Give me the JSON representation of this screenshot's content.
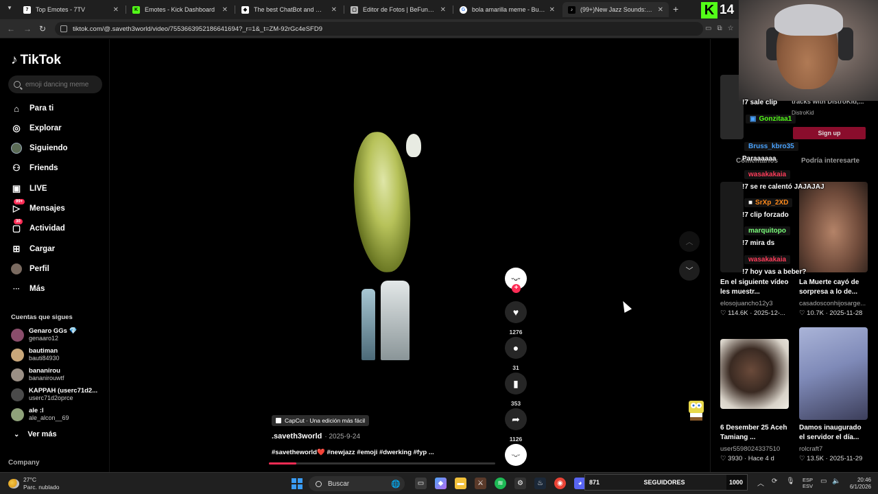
{
  "browser": {
    "tabs": [
      {
        "label": "Top Emotes - 7TV",
        "icon_color": "#ffffff",
        "active": false
      },
      {
        "label": "Emotes - Kick Dashboard",
        "icon_color": "#53fc18",
        "active": false
      },
      {
        "label": "The best ChatBot and Widgets",
        "icon_color": "#ffffff",
        "active": false
      },
      {
        "label": "Editor de Fotos | BeFunky: Edita",
        "icon_color": "#bbbbbb",
        "active": false
      },
      {
        "label": "bola amarilla meme - Buscar co",
        "icon_color": "#ffffff",
        "active": false
      },
      {
        "label": "(99+)New Jazz Sounds: Saving",
        "icon_color": "#ffffff",
        "active": true
      }
    ],
    "url": "tiktok.com/@.saveth3world/video/7553663952186641694?_r=1&_t=ZM-92rGc4eSFD9"
  },
  "tiktok": {
    "logo_text": "TikTok",
    "search_placeholder": "emoji dancing meme",
    "nav": [
      {
        "label": "Para ti",
        "icon": "home-icon",
        "glyph": "⌂"
      },
      {
        "label": "Explorar",
        "icon": "compass-icon",
        "glyph": "◎"
      },
      {
        "label": "Siguiendo",
        "icon": "following-avatar-icon",
        "glyph": "●"
      },
      {
        "label": "Friends",
        "icon": "friends-icon",
        "glyph": "⚇"
      },
      {
        "label": "LIVE",
        "icon": "live-icon",
        "glyph": "▣"
      },
      {
        "label": "Mensajes",
        "icon": "messages-icon",
        "glyph": "▷",
        "badge": "99+"
      },
      {
        "label": "Actividad",
        "icon": "activity-icon",
        "glyph": "▢",
        "badge": "30"
      },
      {
        "label": "Cargar",
        "icon": "upload-icon",
        "glyph": "⊞"
      },
      {
        "label": "Perfil",
        "icon": "profile-icon",
        "glyph": "●"
      },
      {
        "label": "Más",
        "icon": "more-icon",
        "glyph": "···"
      }
    ],
    "following_title": "Cuentas que sigues",
    "following": [
      {
        "name": "Genaro GGs 💎",
        "user": "genaaro12"
      },
      {
        "name": "bautiman",
        "user": "bauti84930"
      },
      {
        "name": "bananirou",
        "user": "bananirouwtf"
      },
      {
        "name": "KAPPAH (userc71d2...",
        "user": "userc71d2oprce"
      },
      {
        "name": "ale :l",
        "user": "ale_alcon__69"
      }
    ],
    "see_more": "Ver más",
    "company": "Company",
    "video": {
      "capcut_label": "CapCut · Una edición más fácil",
      "author": ".saveth3world",
      "date": "· 2025-9-24",
      "caption": "#savetheworld❤️ #newjazz #emoji #dwerking #fyp ...",
      "progress": 0.12,
      "likes": "1276",
      "comments": "31",
      "saves": "353",
      "shares": "1126"
    },
    "right": {
      "sale_clip": "!7 sale clip",
      "tracks_text": "tracks with DistroKid,...",
      "distrokid": "DistroKid",
      "signup": "Sign up",
      "tab_comments": "Comentarios",
      "tab_suggested": "Podría interesarte",
      "cards": [
        {
          "title": "En el siguiente vídeo les muestr...",
          "user": "elosojuancho12y3",
          "stats": "♡ 114.6K · 2025-12-..."
        },
        {
          "title": "La Muerte cayó de sorpresa a lo de...",
          "user": "casadosconhijosarge...",
          "stats": "♡ 10.7K · 2025-11-28"
        },
        {
          "title": "6 Desember 25 Aceh Tamiang ...",
          "user": "user5598024337510",
          "stats": "♡ 3930 · Hace 4 d"
        },
        {
          "title": "Damos inaugurado el servidor el día...",
          "user": "rolcraft7",
          "stats": "♡ 13.5K · 2025-11-29"
        }
      ]
    }
  },
  "stream": {
    "kick_count": "14",
    "chat": [
      {
        "name": "Gonzitaa1",
        "color": "#53fc18",
        "msg": "Paraaaaaa"
      },
      {
        "name": "Bruss_kbro35",
        "color": "#4aa3ff",
        "msg": ""
      },
      {
        "name": "wasakakaia",
        "color": "#ff3c5a",
        "msg": "!7 se re calentó JAJAJAJ"
      },
      {
        "name": "SrXp_2XD",
        "color": "#ff8a1c",
        "msg": "!7 clip forzado"
      },
      {
        "name": "marquitopo",
        "color": "#7bff7b",
        "msg": "!7 mira ds"
      },
      {
        "name": "wasakakaia",
        "color": "#ff3c5a",
        "msg": "!7 hoy vas a beber?"
      }
    ],
    "followers_current": "871",
    "followers_label": "SEGUIDORES",
    "followers_goal": "1000",
    "followers_progress": 0.871
  },
  "taskbar": {
    "temp": "27°C",
    "weather": "Parc. nublado",
    "search": "Buscar",
    "lang1": "ESP",
    "lang2": "ESV",
    "time": "20:46",
    "date": "6/1/2026"
  }
}
